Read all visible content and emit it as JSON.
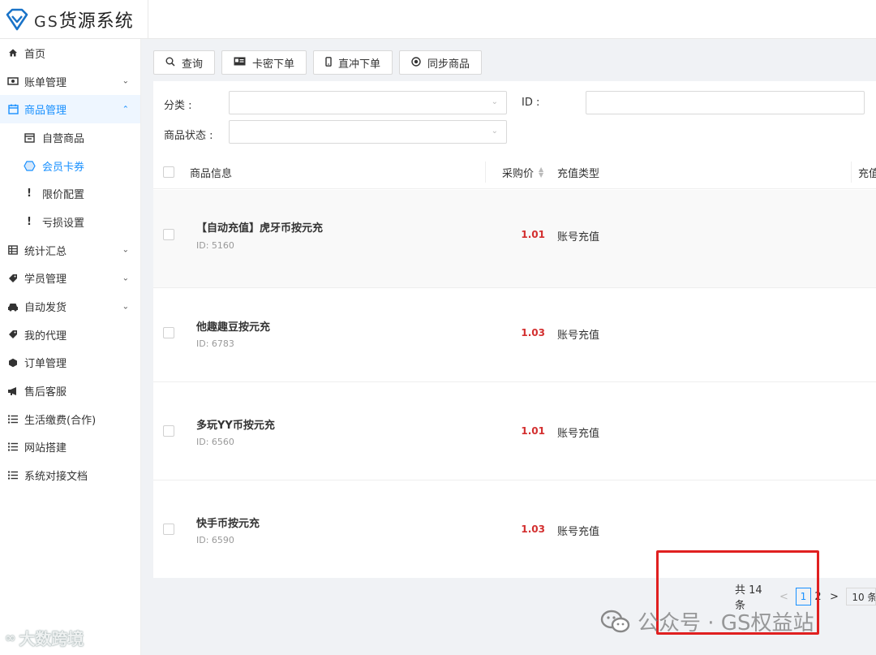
{
  "app": {
    "brand_gs": "GS",
    "brand_cn": "货源系统"
  },
  "sidebar": {
    "items": [
      {
        "label": "首页",
        "icon": "home-icon"
      },
      {
        "label": "账单管理",
        "icon": "bill-icon",
        "expandable": true
      },
      {
        "label": "商品管理",
        "icon": "calendar-icon",
        "expandable": true,
        "expanded": true,
        "active": true
      },
      {
        "label": "自营商品",
        "icon": "calendar-icon",
        "sub": true
      },
      {
        "label": "会员卡券",
        "icon": "coupon-icon",
        "sub": true,
        "selected": true
      },
      {
        "label": "限价配置",
        "icon": "exclamation-icon",
        "sub": true
      },
      {
        "label": "亏损设置",
        "icon": "exclamation-icon",
        "sub": true
      },
      {
        "label": "统计汇总",
        "icon": "table-icon",
        "expandable": true
      },
      {
        "label": "学员管理",
        "icon": "tag-icon",
        "expandable": true
      },
      {
        "label": "自动发货",
        "icon": "car-icon",
        "expandable": true
      },
      {
        "label": "我的代理",
        "icon": "tag-icon"
      },
      {
        "label": "订单管理",
        "icon": "cube-icon"
      },
      {
        "label": "售后客服",
        "icon": "megaphone-icon"
      },
      {
        "label": "生活缴费(合作)",
        "icon": "list-icon"
      },
      {
        "label": "网站搭建",
        "icon": "list-icon"
      },
      {
        "label": "系统对接文档",
        "icon": "list-icon"
      }
    ]
  },
  "toolbar": {
    "query": "查询",
    "card_order": "卡密下单",
    "direct_order": "直冲下单",
    "sync": "同步商品"
  },
  "filters": {
    "category_label": "分类 :",
    "id_label": "ID :",
    "status_label": "商品状态 :"
  },
  "table": {
    "headers": {
      "info": "商品信息",
      "price": "采购价",
      "type": "充值类型",
      "type2": "充值"
    },
    "rows": [
      {
        "name": "【自动充值】虎牙币按元充",
        "id": "ID: 5160",
        "price": "1.01",
        "type": "账号充值"
      },
      {
        "name": "他趣趣豆按元充",
        "id": "ID: 6783",
        "price": "1.03",
        "type": "账号充值"
      },
      {
        "name": "多玩YY币按元充",
        "id": "ID: 6560",
        "price": "1.01",
        "type": "账号充值"
      },
      {
        "name": "快手币按元充",
        "id": "ID: 6590",
        "price": "1.03",
        "type": "账号充值"
      }
    ]
  },
  "pagination": {
    "total": "共 14 条",
    "prev": "<",
    "current": "1",
    "page2": "2",
    "next": ">",
    "size": "10 条"
  },
  "watermarks": {
    "left": "大数跨境",
    "right": "公众号 · GS权益站"
  },
  "colors": {
    "accent": "#1890ff",
    "price": "#d32f2f",
    "highlight_box": "#e02020"
  }
}
